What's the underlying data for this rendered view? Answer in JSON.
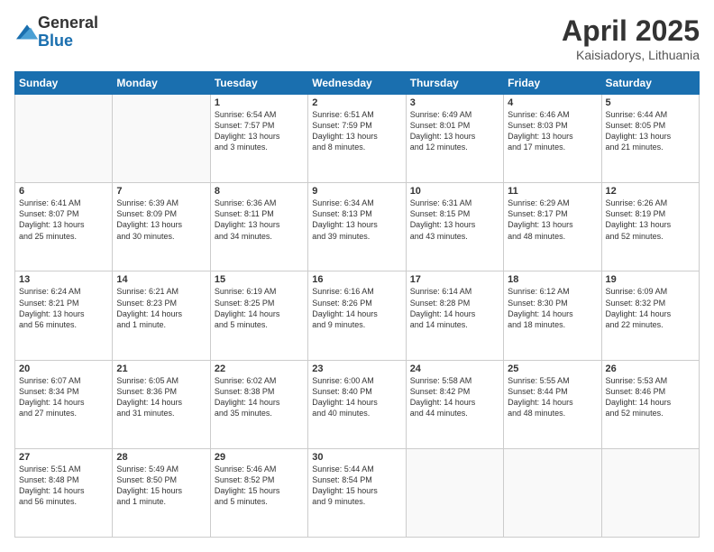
{
  "logo": {
    "general": "General",
    "blue": "Blue"
  },
  "header": {
    "month": "April 2025",
    "location": "Kaisiadorys, Lithuania"
  },
  "days_of_week": [
    "Sunday",
    "Monday",
    "Tuesday",
    "Wednesday",
    "Thursday",
    "Friday",
    "Saturday"
  ],
  "weeks": [
    [
      {
        "day": "",
        "info": ""
      },
      {
        "day": "",
        "info": ""
      },
      {
        "day": "1",
        "info": "Sunrise: 6:54 AM\nSunset: 7:57 PM\nDaylight: 13 hours\nand 3 minutes."
      },
      {
        "day": "2",
        "info": "Sunrise: 6:51 AM\nSunset: 7:59 PM\nDaylight: 13 hours\nand 8 minutes."
      },
      {
        "day": "3",
        "info": "Sunrise: 6:49 AM\nSunset: 8:01 PM\nDaylight: 13 hours\nand 12 minutes."
      },
      {
        "day": "4",
        "info": "Sunrise: 6:46 AM\nSunset: 8:03 PM\nDaylight: 13 hours\nand 17 minutes."
      },
      {
        "day": "5",
        "info": "Sunrise: 6:44 AM\nSunset: 8:05 PM\nDaylight: 13 hours\nand 21 minutes."
      }
    ],
    [
      {
        "day": "6",
        "info": "Sunrise: 6:41 AM\nSunset: 8:07 PM\nDaylight: 13 hours\nand 25 minutes."
      },
      {
        "day": "7",
        "info": "Sunrise: 6:39 AM\nSunset: 8:09 PM\nDaylight: 13 hours\nand 30 minutes."
      },
      {
        "day": "8",
        "info": "Sunrise: 6:36 AM\nSunset: 8:11 PM\nDaylight: 13 hours\nand 34 minutes."
      },
      {
        "day": "9",
        "info": "Sunrise: 6:34 AM\nSunset: 8:13 PM\nDaylight: 13 hours\nand 39 minutes."
      },
      {
        "day": "10",
        "info": "Sunrise: 6:31 AM\nSunset: 8:15 PM\nDaylight: 13 hours\nand 43 minutes."
      },
      {
        "day": "11",
        "info": "Sunrise: 6:29 AM\nSunset: 8:17 PM\nDaylight: 13 hours\nand 48 minutes."
      },
      {
        "day": "12",
        "info": "Sunrise: 6:26 AM\nSunset: 8:19 PM\nDaylight: 13 hours\nand 52 minutes."
      }
    ],
    [
      {
        "day": "13",
        "info": "Sunrise: 6:24 AM\nSunset: 8:21 PM\nDaylight: 13 hours\nand 56 minutes."
      },
      {
        "day": "14",
        "info": "Sunrise: 6:21 AM\nSunset: 8:23 PM\nDaylight: 14 hours\nand 1 minute."
      },
      {
        "day": "15",
        "info": "Sunrise: 6:19 AM\nSunset: 8:25 PM\nDaylight: 14 hours\nand 5 minutes."
      },
      {
        "day": "16",
        "info": "Sunrise: 6:16 AM\nSunset: 8:26 PM\nDaylight: 14 hours\nand 9 minutes."
      },
      {
        "day": "17",
        "info": "Sunrise: 6:14 AM\nSunset: 8:28 PM\nDaylight: 14 hours\nand 14 minutes."
      },
      {
        "day": "18",
        "info": "Sunrise: 6:12 AM\nSunset: 8:30 PM\nDaylight: 14 hours\nand 18 minutes."
      },
      {
        "day": "19",
        "info": "Sunrise: 6:09 AM\nSunset: 8:32 PM\nDaylight: 14 hours\nand 22 minutes."
      }
    ],
    [
      {
        "day": "20",
        "info": "Sunrise: 6:07 AM\nSunset: 8:34 PM\nDaylight: 14 hours\nand 27 minutes."
      },
      {
        "day": "21",
        "info": "Sunrise: 6:05 AM\nSunset: 8:36 PM\nDaylight: 14 hours\nand 31 minutes."
      },
      {
        "day": "22",
        "info": "Sunrise: 6:02 AM\nSunset: 8:38 PM\nDaylight: 14 hours\nand 35 minutes."
      },
      {
        "day": "23",
        "info": "Sunrise: 6:00 AM\nSunset: 8:40 PM\nDaylight: 14 hours\nand 40 minutes."
      },
      {
        "day": "24",
        "info": "Sunrise: 5:58 AM\nSunset: 8:42 PM\nDaylight: 14 hours\nand 44 minutes."
      },
      {
        "day": "25",
        "info": "Sunrise: 5:55 AM\nSunset: 8:44 PM\nDaylight: 14 hours\nand 48 minutes."
      },
      {
        "day": "26",
        "info": "Sunrise: 5:53 AM\nSunset: 8:46 PM\nDaylight: 14 hours\nand 52 minutes."
      }
    ],
    [
      {
        "day": "27",
        "info": "Sunrise: 5:51 AM\nSunset: 8:48 PM\nDaylight: 14 hours\nand 56 minutes."
      },
      {
        "day": "28",
        "info": "Sunrise: 5:49 AM\nSunset: 8:50 PM\nDaylight: 15 hours\nand 1 minute."
      },
      {
        "day": "29",
        "info": "Sunrise: 5:46 AM\nSunset: 8:52 PM\nDaylight: 15 hours\nand 5 minutes."
      },
      {
        "day": "30",
        "info": "Sunrise: 5:44 AM\nSunset: 8:54 PM\nDaylight: 15 hours\nand 9 minutes."
      },
      {
        "day": "",
        "info": ""
      },
      {
        "day": "",
        "info": ""
      },
      {
        "day": "",
        "info": ""
      }
    ]
  ]
}
